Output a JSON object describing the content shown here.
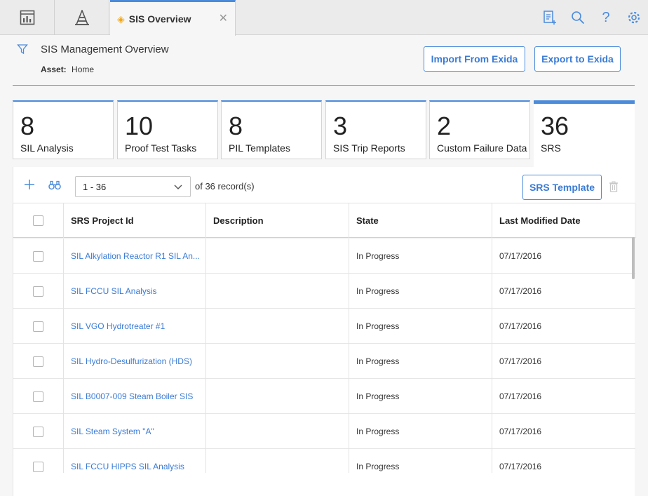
{
  "tabs": {
    "active_title": "SIS Overview"
  },
  "header": {
    "title": "SIS Management Overview",
    "asset_label": "Asset:",
    "asset_value": "Home",
    "import_button": "Import From Exida",
    "export_button": "Export to Exida"
  },
  "cards": [
    {
      "count": "8",
      "label": "SIL Analysis"
    },
    {
      "count": "10",
      "label": "Proof Test Tasks"
    },
    {
      "count": "8",
      "label": "PIL Templates"
    },
    {
      "count": "3",
      "label": "SIS Trip Reports"
    },
    {
      "count": "2",
      "label": "Custom Failure Data"
    },
    {
      "count": "36",
      "label": "SRS"
    }
  ],
  "grid": {
    "range": "1 - 36",
    "of_text": "of 36 record(s)",
    "template_button": "SRS Template",
    "columns": [
      "SRS Project Id",
      "Description",
      "State",
      "Last Modified Date"
    ],
    "rows": [
      {
        "id": "SIL Alkylation Reactor R1 SIL An...",
        "description": "",
        "state": "In Progress",
        "date": "07/17/2016"
      },
      {
        "id": "SIL FCCU SIL Analysis",
        "description": "",
        "state": "In Progress",
        "date": "07/17/2016"
      },
      {
        "id": "SIL VGO Hydrotreater #1",
        "description": "",
        "state": "In Progress",
        "date": "07/17/2016"
      },
      {
        "id": "SIL Hydro-Desulfurization (HDS)",
        "description": "",
        "state": "In Progress",
        "date": "07/17/2016"
      },
      {
        "id": "SIL B0007-009 Steam Boiler SIS",
        "description": "",
        "state": "In Progress",
        "date": "07/17/2016"
      },
      {
        "id": "SIL Steam System \"A\"",
        "description": "",
        "state": "In Progress",
        "date": "07/17/2016"
      },
      {
        "id": "SIL FCCU HIPPS SIL Analysis",
        "description": "",
        "state": "In Progress",
        "date": "07/17/2016"
      }
    ]
  },
  "colors": {
    "accent": "#4a8bdc",
    "link": "#3a7bd5",
    "tab_diamond": "#f0a81c"
  },
  "icons": [
    "dashboard-icon",
    "asset-hierarchy-icon",
    "diamond-icon",
    "close-icon",
    "new-document-icon",
    "search-icon",
    "help-icon",
    "settings-icon",
    "filter-icon",
    "add-icon",
    "binoculars-icon",
    "chevron-down-icon",
    "trash-icon"
  ]
}
